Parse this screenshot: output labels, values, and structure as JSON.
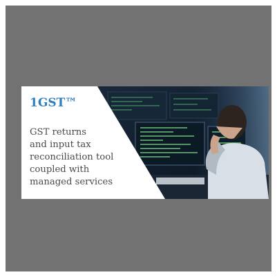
{
  "banner": {
    "brand": "1GST™",
    "tagline_lines": [
      "GST returns",
      "and input tax",
      "reconciliation tool",
      "coupled with",
      "managed services"
    ],
    "image": "person-at-monitors-photo"
  },
  "colors": {
    "frame": "#727272",
    "brand": "#2e7fbf",
    "text": "#4a4a4a",
    "panel": "#ffffff"
  }
}
